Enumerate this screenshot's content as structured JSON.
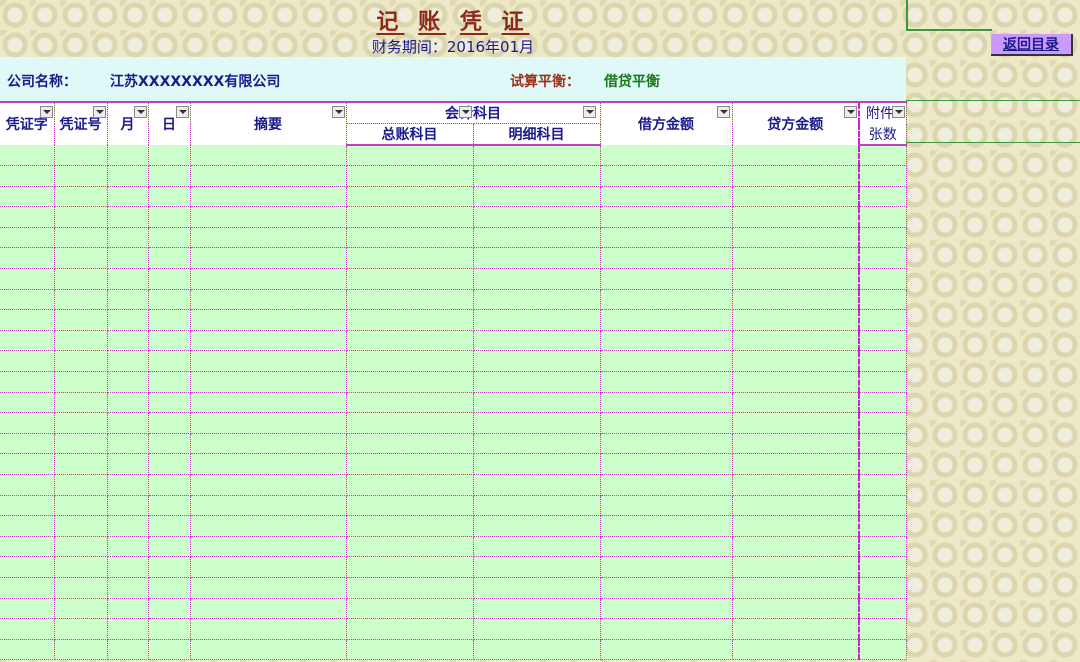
{
  "header": {
    "title_chars": [
      "记",
      "账",
      "凭",
      "证"
    ],
    "period": "财务期间：2016年01月",
    "return_button": "返回目录"
  },
  "info": {
    "company_label": "公司名称：",
    "company_name": "江苏XXXXXXXX有限公司",
    "balance_label": "试算平衡：",
    "balance_value": "借贷平衡"
  },
  "columns": {
    "voucher_type": "凭证字",
    "voucher_no": "凭证号",
    "month": "月",
    "day": "日",
    "summary": "摘要",
    "account": "会计科目",
    "general_account": "总账科目",
    "detail_account": "明细科目",
    "debit": "借方金额",
    "credit": "贷方金额",
    "attach_top": "附件",
    "attach_bottom": "张数"
  },
  "colors": {
    "title": "#8b2a1a",
    "grid_fill": "#ccffcc",
    "info_fill": "#dff8f8",
    "button": "#cc99ff",
    "border": "#c040c0"
  }
}
